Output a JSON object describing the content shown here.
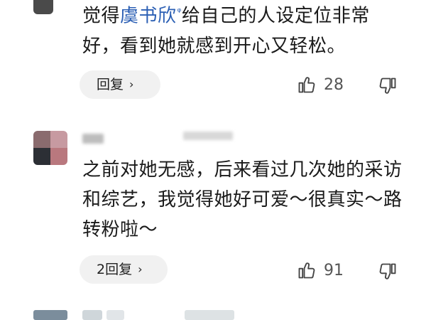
{
  "comments": [
    {
      "text_before": "觉得",
      "mention": "虞书欣",
      "text_after": "给自己的人设定位非常好，看到她就感到开心又轻松。",
      "reply_label": "回复",
      "likes": "28"
    },
    {
      "text": "之前对她无感，后来看过几次她的采访和综艺，我觉得她好可爱～很真实～路转粉啦～",
      "reply_label": "2回复",
      "likes": "91"
    }
  ],
  "icons": {
    "chevron": "›",
    "mention_icon": "ᵠ"
  }
}
